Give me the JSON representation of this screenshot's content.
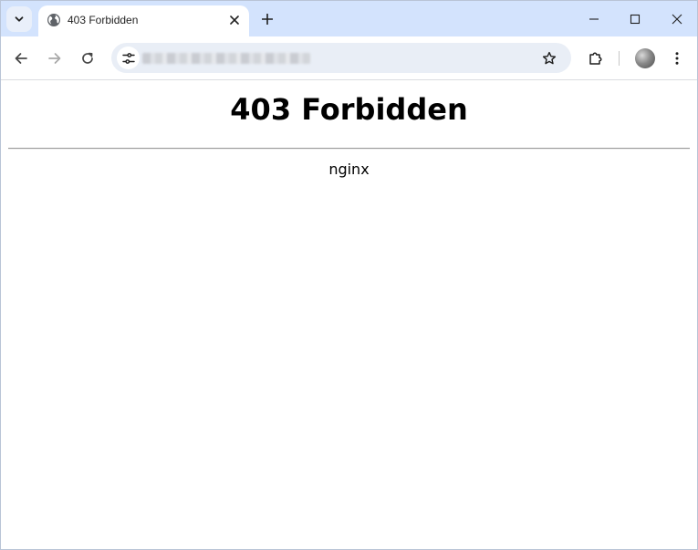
{
  "browser": {
    "tab": {
      "title": "403 Forbidden",
      "favicon": "globe-icon"
    },
    "address_bar": {
      "url": ""
    },
    "icons": {
      "tab_search": "chevron-down-icon",
      "tab_close": "close-icon",
      "new_tab": "plus-icon",
      "minimize": "minimize-icon",
      "maximize": "maximize-icon",
      "close_window": "close-window-icon",
      "back": "back-arrow-icon",
      "forward": "forward-arrow-icon",
      "reload": "reload-icon",
      "site_info": "tune-icon",
      "bookmark": "star-icon",
      "extensions": "puzzle-icon",
      "profile": "avatar",
      "menu": "kebab-menu-icon"
    },
    "colors": {
      "tabstrip": "#d3e3fd",
      "omnibox": "#e9eef6",
      "icon": "#474747"
    }
  },
  "page": {
    "heading": "403 Forbidden",
    "server": "nginx"
  }
}
